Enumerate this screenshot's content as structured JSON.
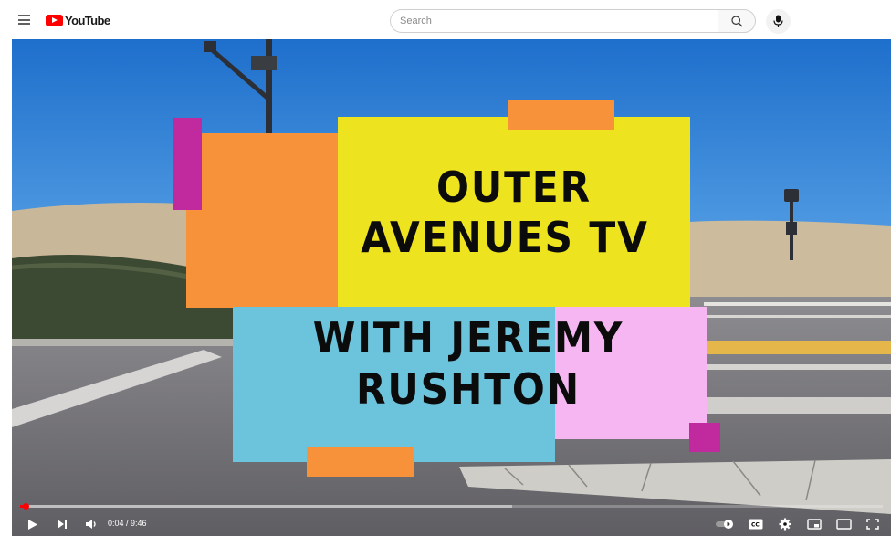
{
  "header": {
    "menu_icon": "hamburger-menu-icon",
    "logo_text": "YouTube",
    "logo_color": "#ff0000",
    "search_placeholder": "Search",
    "search_icon": "magnifier-icon",
    "mic_icon": "microphone-icon"
  },
  "video": {
    "title_lines": [
      "OUTER",
      "AVENUES TV",
      "WITH JEREMY",
      "RUSHTON"
    ],
    "colors": {
      "orange": "#f7923a",
      "yellow": "#eee31f",
      "magenta": "#c12a9e",
      "blue": "#6cc3dc",
      "pink": "#f6b6f2",
      "sky": "#2b7fd4"
    }
  },
  "player": {
    "current_time": "0:04",
    "duration": "9:46",
    "time_display": "0:04 / 9:46",
    "progress_fraction": 0.007,
    "buffer_fraction": 0.57,
    "controls": [
      "play-icon",
      "next-icon",
      "volume-icon",
      "autoplay-toggle-icon",
      "captions-icon",
      "settings-gear-icon",
      "miniplayer-icon",
      "theater-mode-icon",
      "fullscreen-icon"
    ]
  }
}
